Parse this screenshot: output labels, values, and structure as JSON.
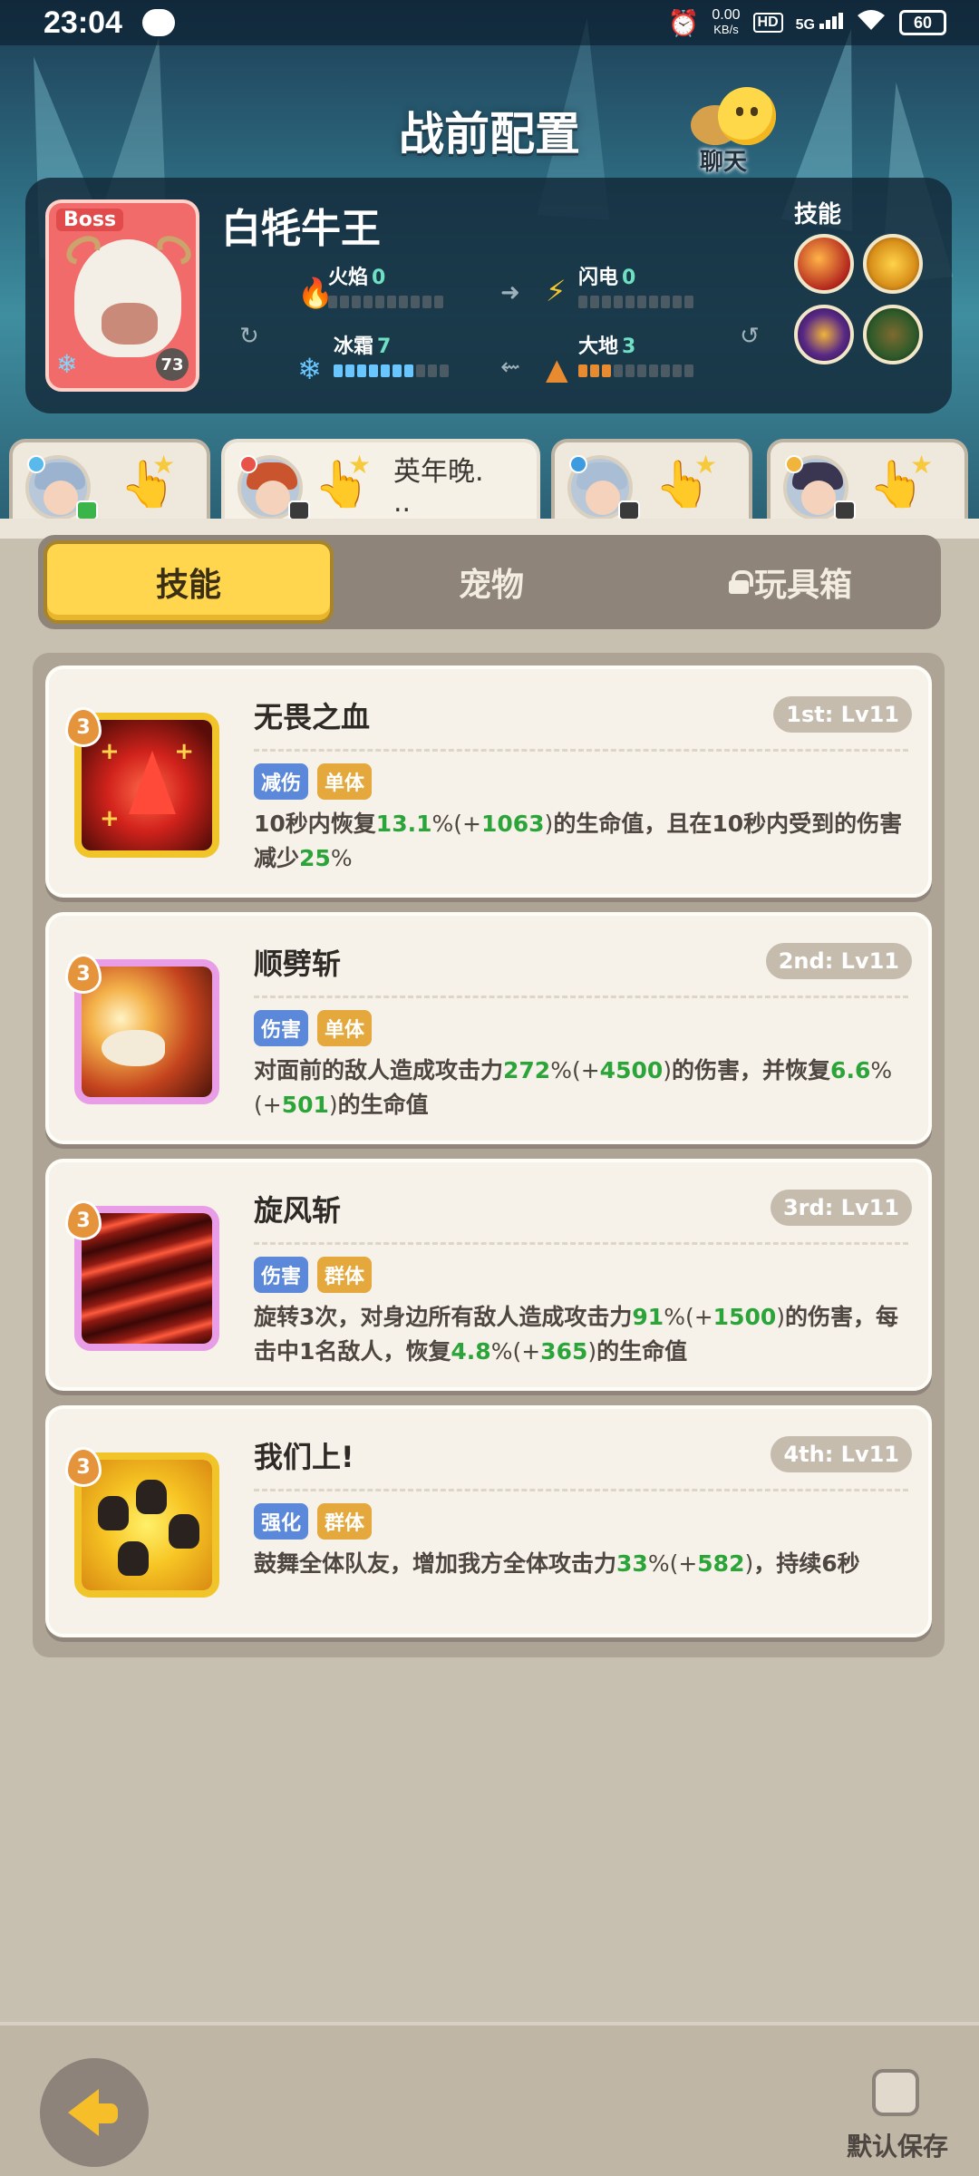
{
  "status_bar": {
    "time": "23:04",
    "net_speed_value": "0.00",
    "net_speed_unit": "KB/s",
    "hd_label": "HD",
    "network": "5G",
    "battery": "60"
  },
  "header": {
    "title": "战前配置",
    "chat_label": "聊天"
  },
  "boss": {
    "tag": "Boss",
    "name": "白牦牛王",
    "level": "73",
    "skills_label": "技能",
    "stats": {
      "fire": {
        "label": "火焰",
        "value": "0",
        "filled": 0,
        "color": "#e45b32"
      },
      "lightning": {
        "label": "闪电",
        "value": "0",
        "filled": 0,
        "color": "#f5c62e"
      },
      "ice": {
        "label": "冰霜",
        "value": "7",
        "filled": 7,
        "color": "#69c6ff"
      },
      "earth": {
        "label": "大地",
        "value": "3",
        "filled": 3,
        "color": "#e88a30"
      }
    }
  },
  "characters": [
    {
      "name": ""
    },
    {
      "name": "英年晚.\n.."
    },
    {
      "name": ""
    },
    {
      "name": ""
    }
  ],
  "tabs": {
    "skills": "技能",
    "pets": "宠物",
    "toybox": "玩具箱"
  },
  "skills": [
    {
      "level_badge": "3",
      "name": "无畏之血",
      "slot": "1st: Lv11",
      "tags": [
        "减伤",
        "单体"
      ],
      "desc": "10秒内恢复<g>13.1</g><p>%(+</p><g>1063</g><p>)</p>的生命值，且在10秒内受到的伤害减少<g>25</g><p>%</p>"
    },
    {
      "level_badge": "3",
      "name": "顺劈斩",
      "slot": "2nd: Lv11",
      "tags": [
        "伤害",
        "单体"
      ],
      "desc": "对面前的敌人造成攻击力<g>272</g><p>%(+</p><g>4500</g><p>)</p>的伤害，并恢复<g>6.6</g><p>%</p><p>(+</p><g>501</g><p>)</p>的生命值"
    },
    {
      "level_badge": "3",
      "name": "旋风斩",
      "slot": "3rd: Lv11",
      "tags": [
        "伤害",
        "群体"
      ],
      "desc": "旋转3次，对身边所有敌人造成攻击力<g>91</g><p>%(+</p><g>1500</g><p>)</p>的伤害，每击中1名敌人，恢复<g>4.8</g><p>%(+</p><g>365</g><p>)</p>的生命值"
    },
    {
      "level_badge": "3",
      "name": "我们上!",
      "slot": "4th: Lv11",
      "tags": [
        "强化",
        "群体"
      ],
      "desc": "鼓舞全体队友，增加我方全体攻击力<g>33</g><p>%(+</p><g>582</g><p>)</p>，持续6秒"
    }
  ],
  "footer": {
    "save_label": "默认保存"
  }
}
